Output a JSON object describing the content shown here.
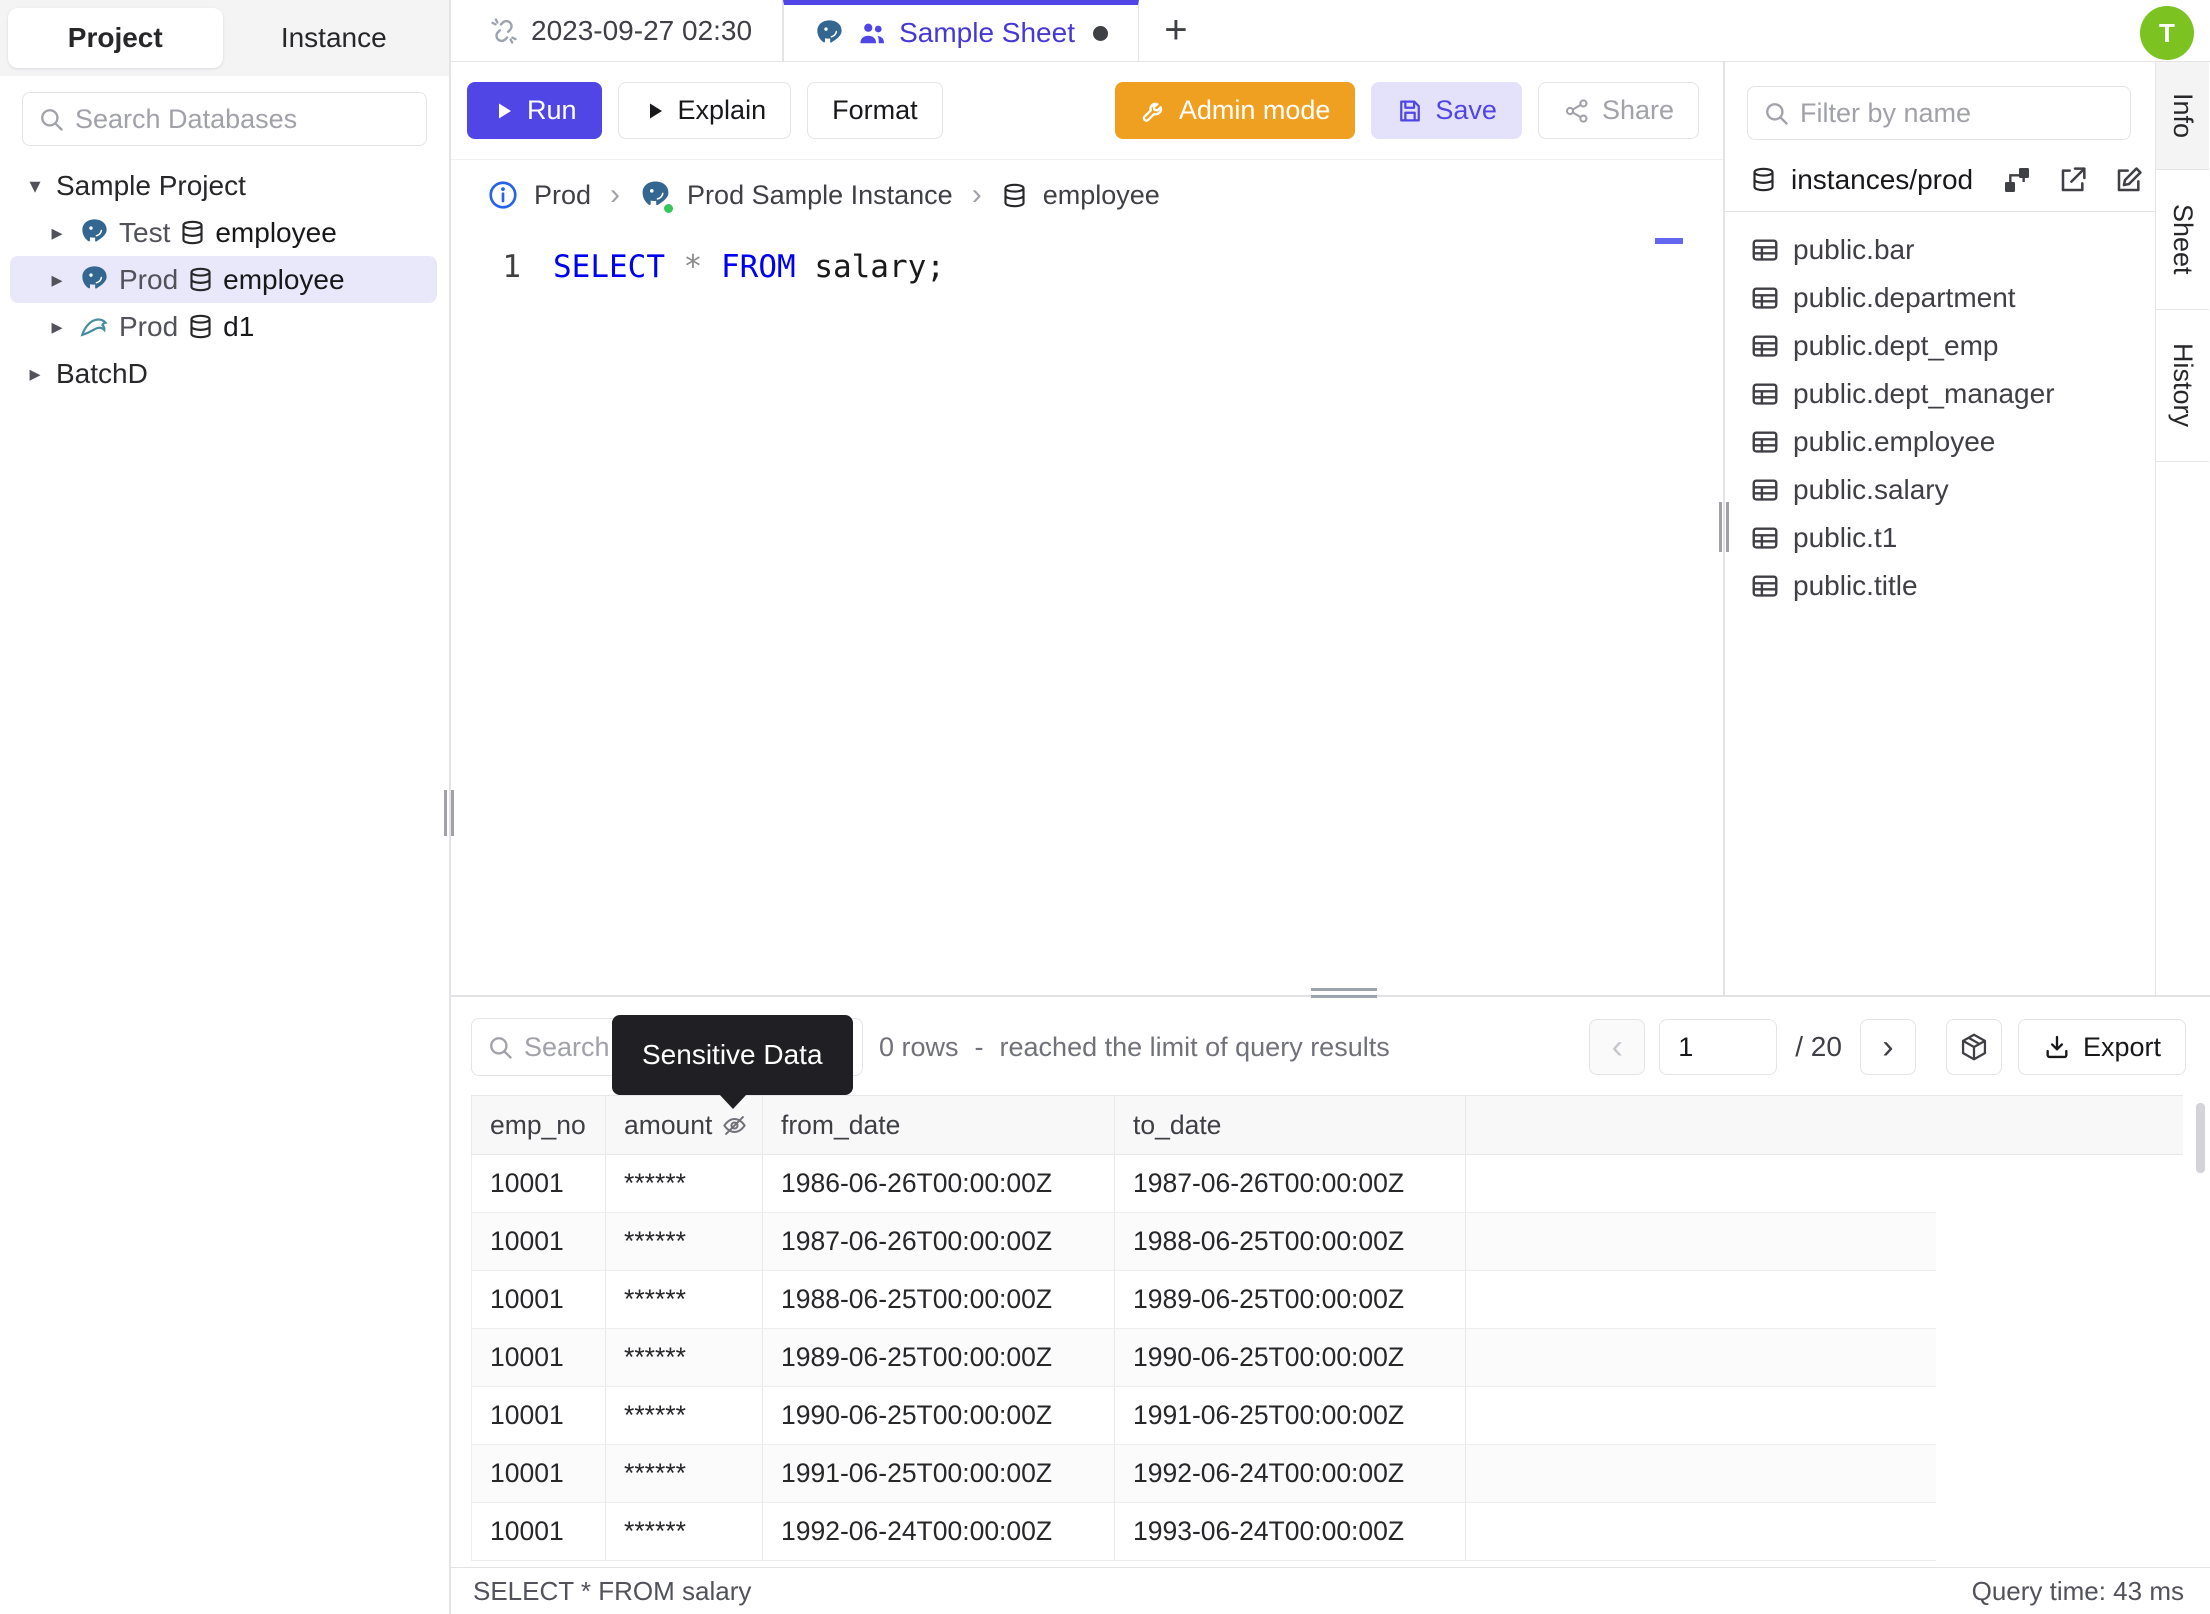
{
  "app": {
    "avatar_initial": "T"
  },
  "left_sidebar": {
    "tabs": {
      "project": "Project",
      "instance": "Instance"
    },
    "search_placeholder": "Search Databases",
    "tree": {
      "project_label": "Sample Project",
      "items": [
        {
          "env": "Test",
          "db": "employee",
          "engine": "postgresql"
        },
        {
          "env": "Prod",
          "db": "employee",
          "engine": "postgresql"
        },
        {
          "env": "Prod",
          "db": "d1",
          "engine": "mysql"
        }
      ],
      "batch_label": "BatchD"
    }
  },
  "tabbar": {
    "tab1": "2023-09-27 02:30",
    "tab2": "Sample Sheet",
    "new_tab": "+"
  },
  "toolbar": {
    "run": "Run",
    "explain": "Explain",
    "format": "Format",
    "admin_mode": "Admin mode",
    "save": "Save",
    "share": "Share"
  },
  "breadcrumb": {
    "env": "Prod",
    "instance": "Prod Sample Instance",
    "database": "employee"
  },
  "editor": {
    "line_number": "1",
    "kw1": "SELECT",
    "star": "*",
    "kw2": "FROM",
    "rest": " salary;"
  },
  "right_sidebar": {
    "filter_placeholder": "Filter by name",
    "schema_path": "instances/prod",
    "tables": [
      "public.bar",
      "public.department",
      "public.dept_emp",
      "public.dept_manager",
      "public.employee",
      "public.salary",
      "public.t1",
      "public.title"
    ],
    "panel_tabs": [
      "Info",
      "Sheet",
      "History"
    ]
  },
  "results": {
    "search_placeholder": "Search",
    "tooltip": "Sensitive Data",
    "row_info": "0 rows",
    "info_sep": "-",
    "limit_info": "reached the limit of query results",
    "pagination": {
      "page": "1",
      "total": "/ 20",
      "prev": "‹",
      "next": "›"
    },
    "export_label": "Export",
    "table": {
      "headers": [
        "emp_no",
        "amount",
        "from_date",
        "to_date"
      ],
      "rows": [
        [
          "10001",
          "******",
          "1986-06-26T00:00:00Z",
          "1987-06-26T00:00:00Z"
        ],
        [
          "10001",
          "******",
          "1987-06-26T00:00:00Z",
          "1988-06-25T00:00:00Z"
        ],
        [
          "10001",
          "******",
          "1988-06-25T00:00:00Z",
          "1989-06-25T00:00:00Z"
        ],
        [
          "10001",
          "******",
          "1989-06-25T00:00:00Z",
          "1990-06-25T00:00:00Z"
        ],
        [
          "10001",
          "******",
          "1990-06-25T00:00:00Z",
          "1991-06-25T00:00:00Z"
        ],
        [
          "10001",
          "******",
          "1991-06-25T00:00:00Z",
          "1992-06-24T00:00:00Z"
        ],
        [
          "10001",
          "******",
          "1992-06-24T00:00:00Z",
          "1993-06-24T00:00:00Z"
        ]
      ]
    },
    "status": {
      "query": "SELECT * FROM salary",
      "time": "Query time: 43 ms"
    }
  },
  "colors": {
    "accent": "#4f46e5",
    "admin_orange": "#f0a020",
    "avatar_green": "#7cc322",
    "keyword_blue": "#0000f0",
    "postgres_blue": "#336791",
    "mysql_teal": "#4a8da0",
    "status_green": "#34c759"
  }
}
